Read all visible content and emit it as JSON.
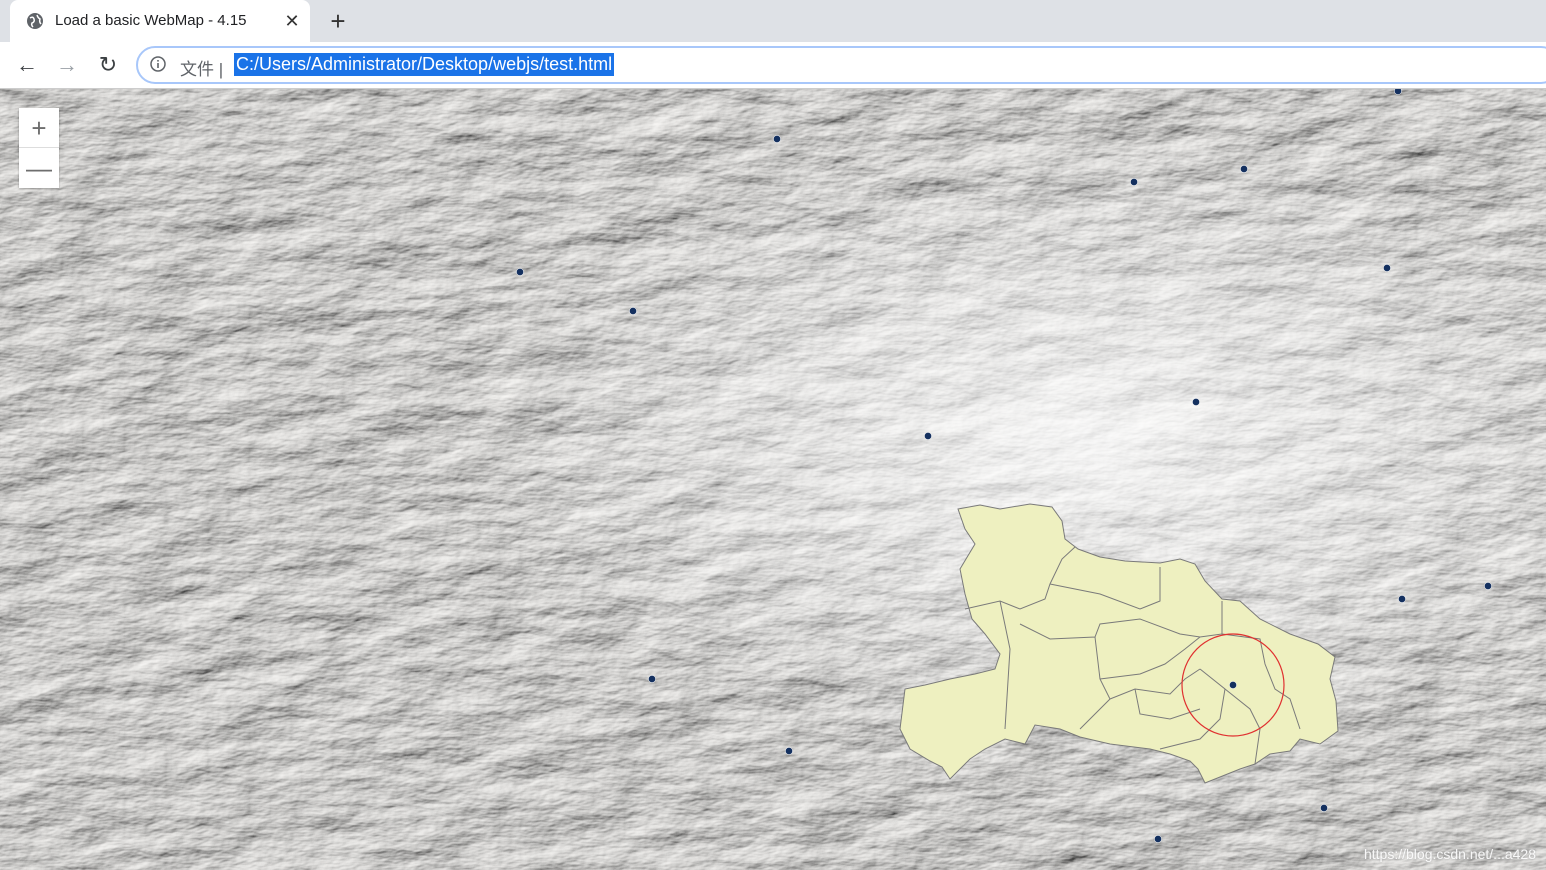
{
  "tab": {
    "title": "Load a basic WebMap - 4.15",
    "favicon": "globe-icon",
    "close": "✕"
  },
  "new_tab": "+",
  "toolbar": {
    "back": "←",
    "forward": "→",
    "reload": "↻"
  },
  "omnibox": {
    "scheme_label": "文件",
    "separator": "|",
    "url": "C:/Users/Administrator/Desktop/webjs/test.html"
  },
  "map": {
    "zoom_in": "+",
    "zoom_out": "—",
    "basemap": "shaded-relief",
    "polygon_fill": "#eef0c0",
    "polygon_stroke": "#7a7a7a",
    "point_color": "#14305f",
    "buffer_color": "#e03030",
    "watermark": "https://blog.csdn.net/...a428"
  }
}
